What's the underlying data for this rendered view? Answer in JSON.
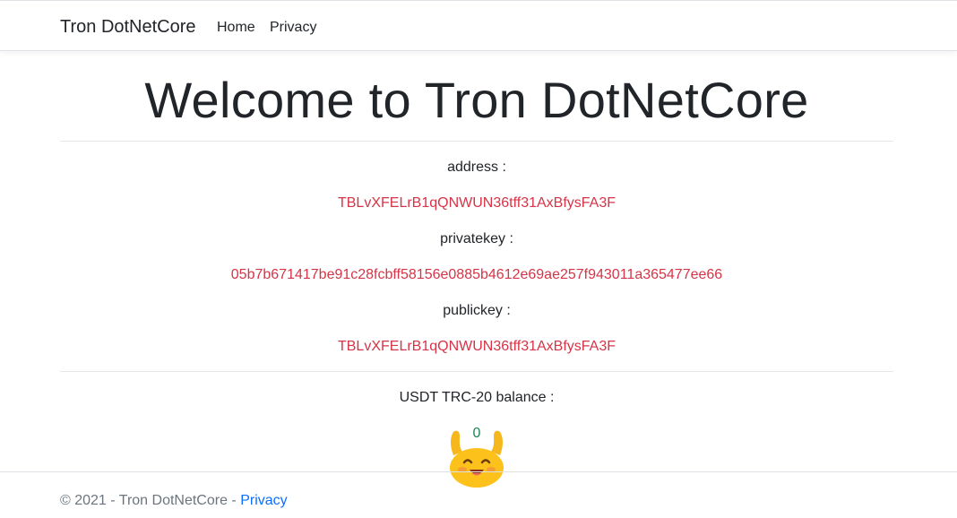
{
  "navbar": {
    "brand": "Tron DotNetCore",
    "links": [
      "Home",
      "Privacy"
    ]
  },
  "main": {
    "title": "Welcome to Tron DotNetCore",
    "address_label": "address :",
    "address_value": "TBLvXFELrB1qQNWUN36tff31AxBfysFA3F",
    "privatekey_label": "privatekey :",
    "privatekey_value": "05b7b671417be91c28fcbff58156e0885b4612e69ae257f943011a365477ee66",
    "publickey_label": "publickey :",
    "publickey_value": "TBLvXFELrB1qQNWUN36tff31AxBfysFA3F",
    "balance_label": "USDT TRC-20 balance :",
    "balance_value": "0"
  },
  "footer": {
    "copyright": "© 2021 - Tron DotNetCore - ",
    "privacy_link": "Privacy"
  },
  "colors": {
    "value_red": "#d63447",
    "balance_green": "#198754",
    "link_blue": "#0d6efd"
  },
  "icons": [
    "celebrate-emoji-icon"
  ]
}
